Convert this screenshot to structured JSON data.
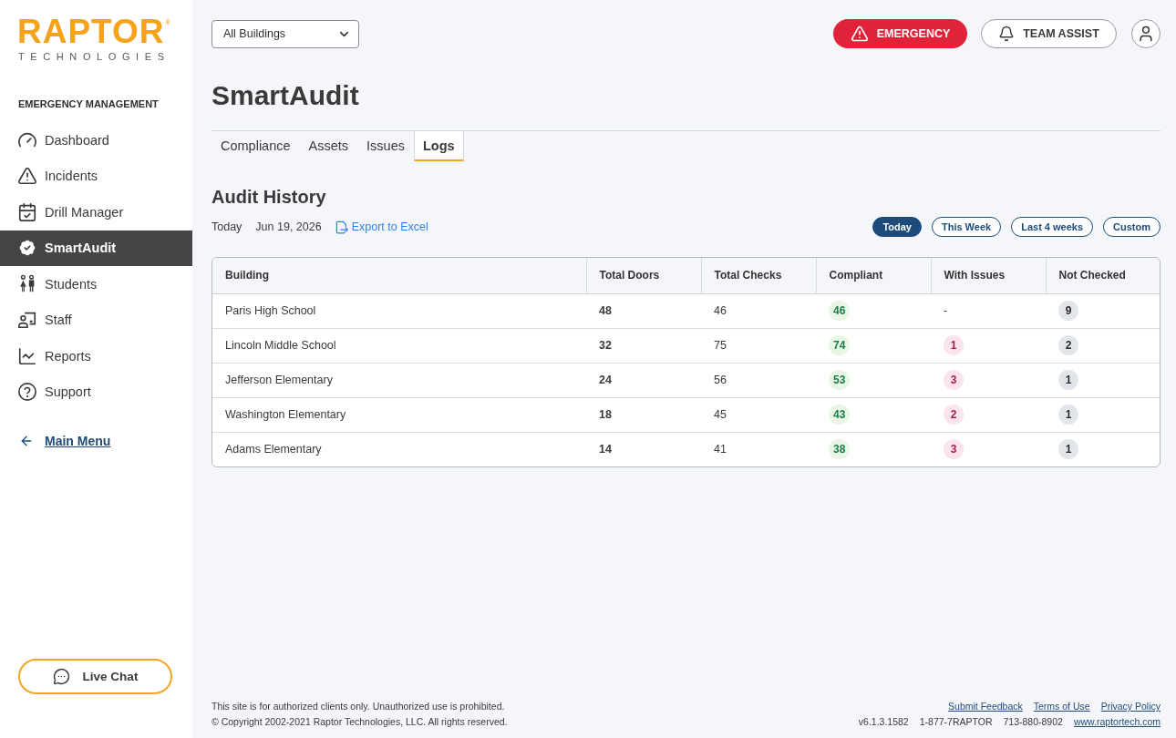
{
  "sidebar": {
    "logo": {
      "wordmark": "RAPTOR$^{®}$",
      "tagline": "TECHNOLOGIES"
    },
    "section_title": "EMERGENCY MANAGEMENT",
    "items": [
      {
        "label": "Dashboard",
        "selected": false
      },
      {
        "label": "Incidents",
        "selected": false
      },
      {
        "label": "Drill Manager",
        "selected": false
      },
      {
        "label": "SmartAudit",
        "selected": true
      },
      {
        "label": "Students",
        "selected": false
      },
      {
        "label": "Staff",
        "selected": false
      },
      {
        "label": "Reports",
        "selected": false
      },
      {
        "label": "Support",
        "selected": false
      }
    ],
    "main_menu_link": "Main Menu",
    "live_chat_button": "Live Chat"
  },
  "top_bar": {
    "building_select": {
      "value": "All Buildings"
    },
    "emergency_button": "EMERGENCY",
    "team_assist_button": "TEAM ASSIST"
  },
  "page_title": "SmartAudit",
  "tabs": [
    {
      "label": "Compliance",
      "selected": false
    },
    {
      "label": "Assets",
      "selected": false
    },
    {
      "label": "Issues",
      "selected": false
    },
    {
      "label": "Logs",
      "selected": true
    }
  ],
  "audit_history": {
    "title": "Audit History",
    "period": "Today",
    "date": "Jun 19, 2026",
    "export_link": "Export to Excel",
    "range_filters": [
      {
        "label": "Today",
        "selected": true
      },
      {
        "label": "This Week",
        "selected": false
      },
      {
        "label": "Last 4 weeks",
        "selected": false
      },
      {
        "label": "Custom",
        "selected": false
      }
    ],
    "table": {
      "columns": [
        "Building",
        "Total Doors",
        "Total Checks",
        "Compliant",
        "With Issues",
        "Not Checked"
      ],
      "rows": [
        {
          "cells": [
            {
              "text": "Paris High School",
              "kind": "text"
            },
            {
              "text": "48",
              "kind": "strong"
            },
            {
              "text": "46",
              "kind": "text"
            },
            {
              "text": "46",
              "kind": "compliant"
            },
            {
              "text": "-",
              "kind": "text"
            },
            {
              "text": "9",
              "kind": "unchecked"
            }
          ]
        },
        {
          "cells": [
            {
              "text": "Lincoln Middle School",
              "kind": "text"
            },
            {
              "text": "32",
              "kind": "strong"
            },
            {
              "text": "75",
              "kind": "text"
            },
            {
              "text": "74",
              "kind": "compliant"
            },
            {
              "text": "1",
              "kind": "issue"
            },
            {
              "text": "2",
              "kind": "unchecked"
            }
          ]
        },
        {
          "cells": [
            {
              "text": "Jefferson Elementary",
              "kind": "text"
            },
            {
              "text": "24",
              "kind": "strong"
            },
            {
              "text": "56",
              "kind": "text"
            },
            {
              "text": "53",
              "kind": "compliant"
            },
            {
              "text": "3",
              "kind": "issue"
            },
            {
              "text": "1",
              "kind": "unchecked"
            }
          ]
        },
        {
          "cells": [
            {
              "text": "Washington Elementary",
              "kind": "text"
            },
            {
              "text": "18",
              "kind": "strong"
            },
            {
              "text": "45",
              "kind": "text"
            },
            {
              "text": "43",
              "kind": "compliant"
            },
            {
              "text": "2",
              "kind": "issue"
            },
            {
              "text": "1",
              "kind": "unchecked"
            }
          ]
        },
        {
          "cells": [
            {
              "text": "Adams Elementary",
              "kind": "text"
            },
            {
              "text": "14",
              "kind": "strong"
            },
            {
              "text": "41",
              "kind": "text"
            },
            {
              "text": "38",
              "kind": "compliant"
            },
            {
              "text": "3",
              "kind": "issue"
            },
            {
              "text": "1",
              "kind": "unchecked"
            }
          ]
        }
      ]
    }
  },
  "footer": {
    "notices": [
      "This site is for authorized clients only. Unauthorized use is prohibited.",
      "© Copyright 2002-2021 Raptor Technologies, LLC. All rights reserved."
    ],
    "links": [
      "Submit Feedback",
      "Terms of Use",
      "Privacy Policy"
    ],
    "details": [
      "v6.1.3.1582",
      "1-877-7RAPTOR",
      "713-880-8902"
    ],
    "website": "www.raptortech.com"
  }
}
